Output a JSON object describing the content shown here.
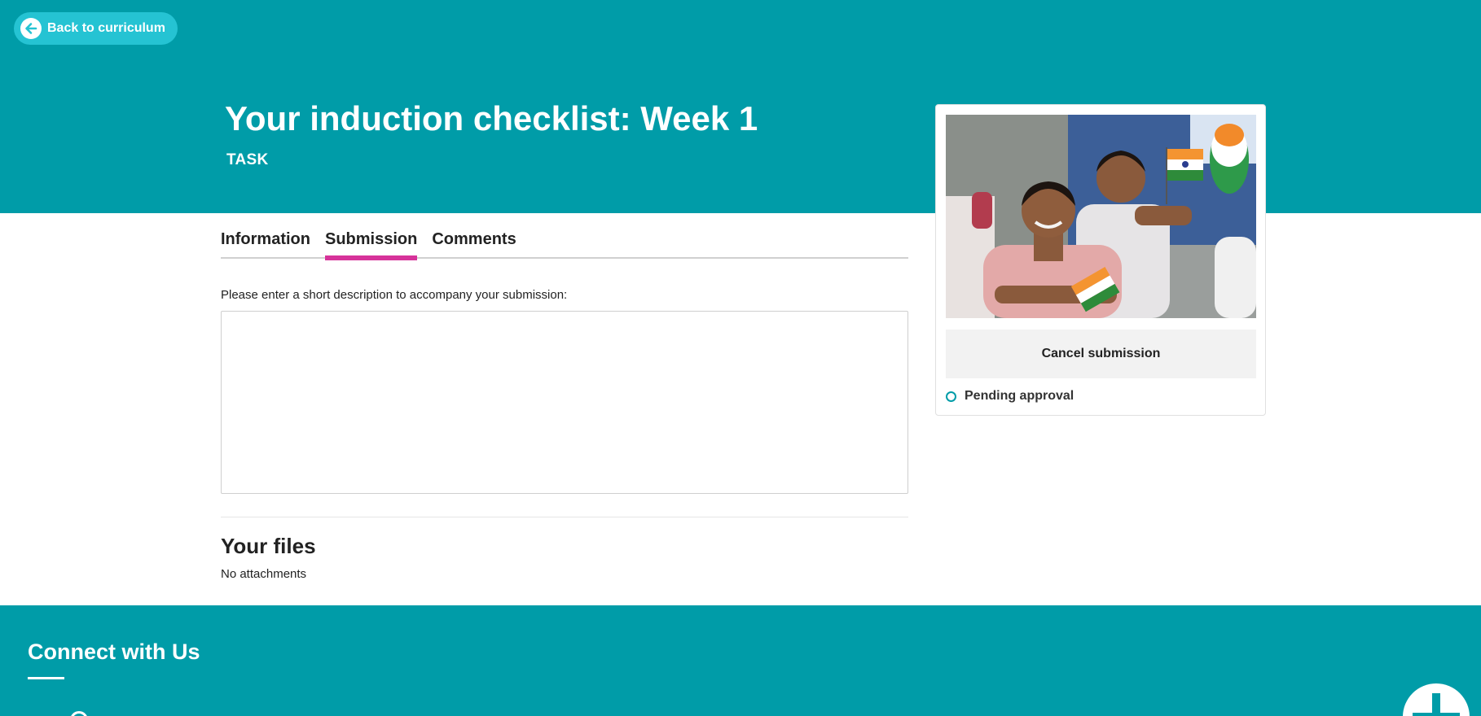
{
  "header": {
    "back_label": "Back to curriculum",
    "title": "Your induction checklist: Week 1",
    "subtitle": "TASK"
  },
  "tabs": [
    {
      "label": "Information",
      "active": false
    },
    {
      "label": "Submission",
      "active": true
    },
    {
      "label": "Comments",
      "active": false
    }
  ],
  "submission": {
    "description_label": "Please enter a short description to accompany your submission:",
    "description_value": ""
  },
  "files": {
    "title": "Your files",
    "empty_text": "No attachments"
  },
  "card": {
    "cancel_label": "Cancel submission",
    "status_text": "Pending approval"
  },
  "footer": {
    "title": "Connect with Us"
  },
  "colors": {
    "brand": "#009ca8",
    "back_button": "#25c3d3",
    "active_tab": "#d6339a"
  },
  "icons": {
    "back": "arrow-left-icon",
    "status": "circle-outline-icon",
    "fab": "plus-icon"
  }
}
